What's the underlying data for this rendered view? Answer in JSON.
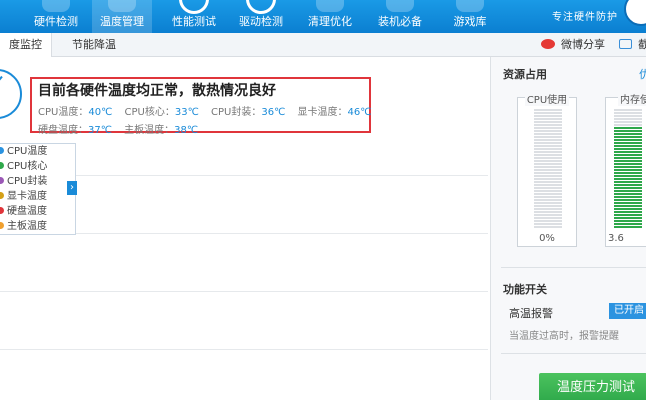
{
  "nav": {
    "items": [
      {
        "label": "硬件检测",
        "icon": "hardware-icon"
      },
      {
        "label": "温度管理",
        "icon": "thermometer-icon",
        "active": true
      },
      {
        "label": "性能测试",
        "icon": "performance-icon"
      },
      {
        "label": "驱动检测",
        "icon": "driver-icon"
      },
      {
        "label": "清理优化",
        "icon": "broom-icon"
      },
      {
        "label": "装机必备",
        "icon": "package-icon"
      },
      {
        "label": "游戏库",
        "icon": "gamepad-icon"
      }
    ],
    "brand_tagline": "专注硬件防护"
  },
  "subtabs": {
    "items": [
      {
        "label": "度监控",
        "active": true
      },
      {
        "label": "节能降温"
      }
    ],
    "weibo_share": "微博分享",
    "screenshot": "截"
  },
  "status": {
    "title": "目前各硬件温度均正常，散热情况良好",
    "readings_row1": [
      {
        "label": "CPU温度：",
        "value": "40℃"
      },
      {
        "label": "CPU核心：",
        "value": "33℃"
      },
      {
        "label": "CPU封装：",
        "value": "36℃"
      },
      {
        "label": "显卡温度：",
        "value": "46℃"
      }
    ],
    "readings_row2": [
      {
        "label": "硬盘温度：",
        "value": "37℃"
      },
      {
        "label": "主板温度：",
        "value": "38℃"
      }
    ]
  },
  "legend": {
    "items": [
      {
        "label": "CPU温度",
        "color": "#2b93e0"
      },
      {
        "label": "CPU核心",
        "color": "#2ea84a"
      },
      {
        "label": "CPU封装",
        "color": "#9b59b6"
      },
      {
        "label": "显卡温度",
        "color": "#d4a017"
      },
      {
        "label": "硬盘温度",
        "color": "#e0353b"
      },
      {
        "label": "主板温度",
        "color": "#f0a030"
      }
    ],
    "toggle": "›"
  },
  "side": {
    "resource_title": "资源占用",
    "optimize_link": "优",
    "cpu_meter": {
      "label": "CPU使用",
      "value": "0%",
      "fill": 0.0
    },
    "mem_meter": {
      "label": "内存使",
      "value": "3.6",
      "fill": 0.85
    },
    "feature_title": "功能开关",
    "feature_name": "高温报警",
    "feature_state": "已开启",
    "feature_desc": "当温度过高时，报警提醒",
    "stress_test": "温度压力测试"
  },
  "colors": {
    "accent": "#1a8bd8",
    "alert_border": "#e0353b",
    "green": "#2ea84a"
  }
}
